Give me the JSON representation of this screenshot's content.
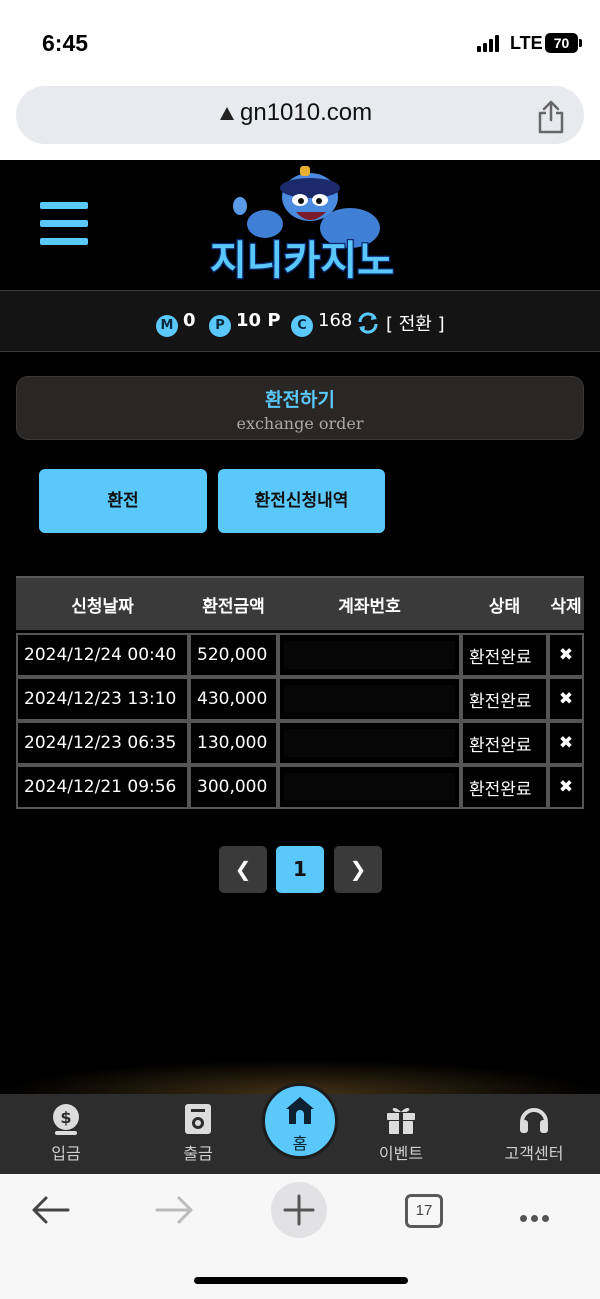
{
  "status": {
    "time": "6:45",
    "network": "LTE",
    "battery": "70"
  },
  "browser": {
    "url": "gn1010.com",
    "tab_count": "17"
  },
  "site": {
    "logo_text": "지니카지노"
  },
  "points": [
    {
      "badge": "M",
      "value": "0"
    },
    {
      "badge": "P",
      "value": "10 P"
    },
    {
      "badge": "C",
      "value": "168"
    }
  ],
  "switch_label": "[ 전환 ]",
  "page": {
    "title": "환전하기",
    "subtitle": "exchange order"
  },
  "buttons": {
    "exchange": "환전",
    "history": "환전신청내역"
  },
  "table": {
    "headers": [
      "신청날짜",
      "환전금액",
      "계좌번호",
      "상태",
      "삭제"
    ],
    "rows": [
      {
        "date": "2024/12/24 00:40",
        "amount": "520,000",
        "status": "환전완료"
      },
      {
        "date": "2024/12/23 13:10",
        "amount": "430,000",
        "status": "환전완료"
      },
      {
        "date": "2024/12/23 06:35",
        "amount": "130,000",
        "status": "환전완료"
      },
      {
        "date": "2024/12/21 09:56",
        "amount": "300,000",
        "status": "환전완료"
      }
    ],
    "delete_icon": "close-icon"
  },
  "pagination": {
    "current": "1"
  },
  "bottom_nav": {
    "deposit": "입금",
    "withdraw": "출금",
    "home": "홈",
    "event": "이벤트",
    "support": "고객센터"
  },
  "colors": {
    "accent": "#5ac8fa",
    "background": "#000000"
  }
}
